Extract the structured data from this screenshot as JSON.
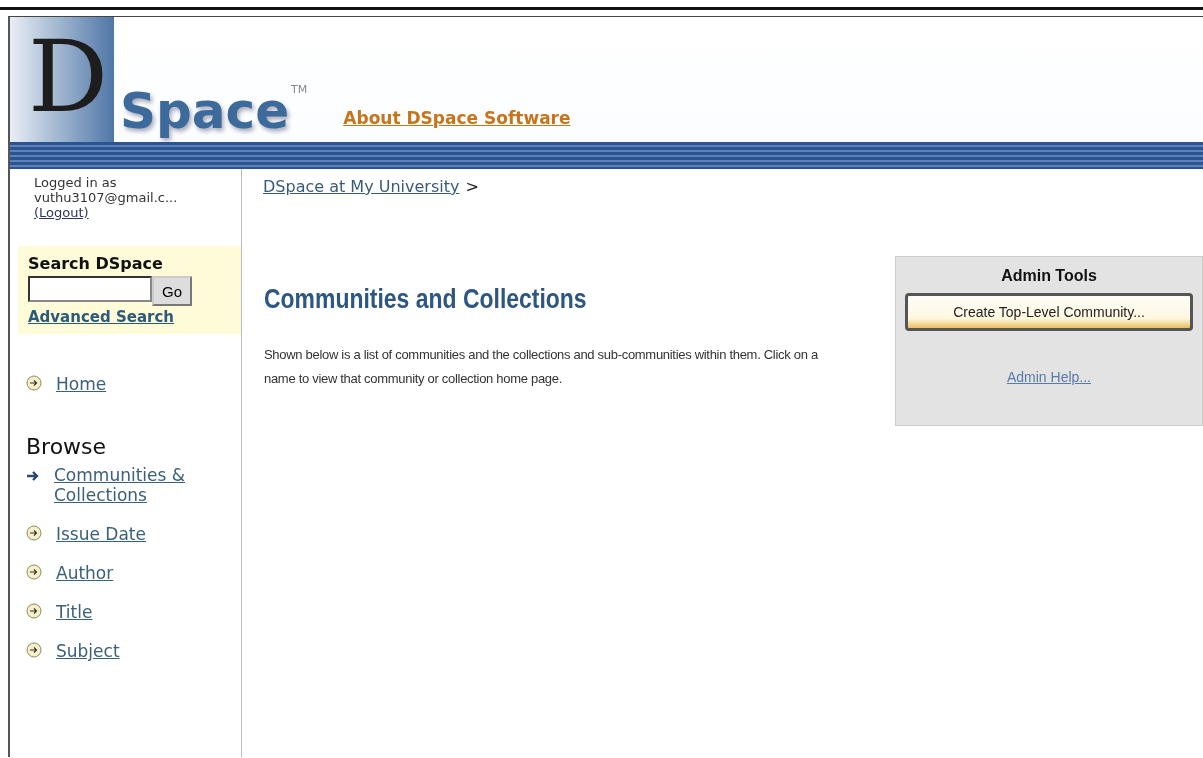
{
  "header": {
    "logo": {
      "initial": "D",
      "word": "Space",
      "mark": "TM"
    },
    "about_link": "About DSpace Software"
  },
  "sidebar": {
    "login": {
      "prefix": "Logged in as",
      "user": "vuthu3107@gmail.c...",
      "logout": "(Logout)"
    },
    "search": {
      "title": "Search DSpace",
      "button": "Go",
      "advanced": "Advanced Search"
    },
    "home": {
      "label": "Home",
      "selected": false
    },
    "browse": {
      "title": "Browse",
      "items": [
        {
          "label": "Communities & Collections",
          "selected": true
        },
        {
          "label": "Issue Date",
          "selected": false
        },
        {
          "label": "Author",
          "selected": false
        },
        {
          "label": "Title",
          "selected": false
        },
        {
          "label": "Subject",
          "selected": false
        }
      ]
    }
  },
  "breadcrumb": {
    "link": "DSpace at My University",
    "separator": ">"
  },
  "main": {
    "title": "Communities and Collections",
    "description": "Shown below is a list of communities and the collections and sub-communities within them. Click on a name to view that community or collection home page."
  },
  "admin_tools": {
    "title": "Admin Tools",
    "button": "Create Top-Level Community...",
    "help": "Admin Help..."
  }
}
